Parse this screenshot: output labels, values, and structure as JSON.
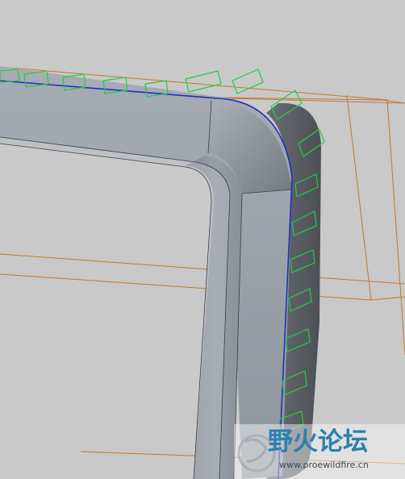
{
  "watermark": {
    "name": "野火论坛",
    "url": "www.proewildfire.cn"
  },
  "colors": {
    "background": "#c9c9c9",
    "datum_plane": "#c07830",
    "top_face": "#9aa0a8",
    "inner_wall": "#8e959d",
    "outer_wall": "#5e6368",
    "edge_highlight": "#2030c0",
    "feature_preview": "#22cc44",
    "watermark_text": "#2d7fb0",
    "watermark_url": "#3a4a55"
  },
  "icons": {
    "watermark_logo": "feather-circle-logo"
  }
}
